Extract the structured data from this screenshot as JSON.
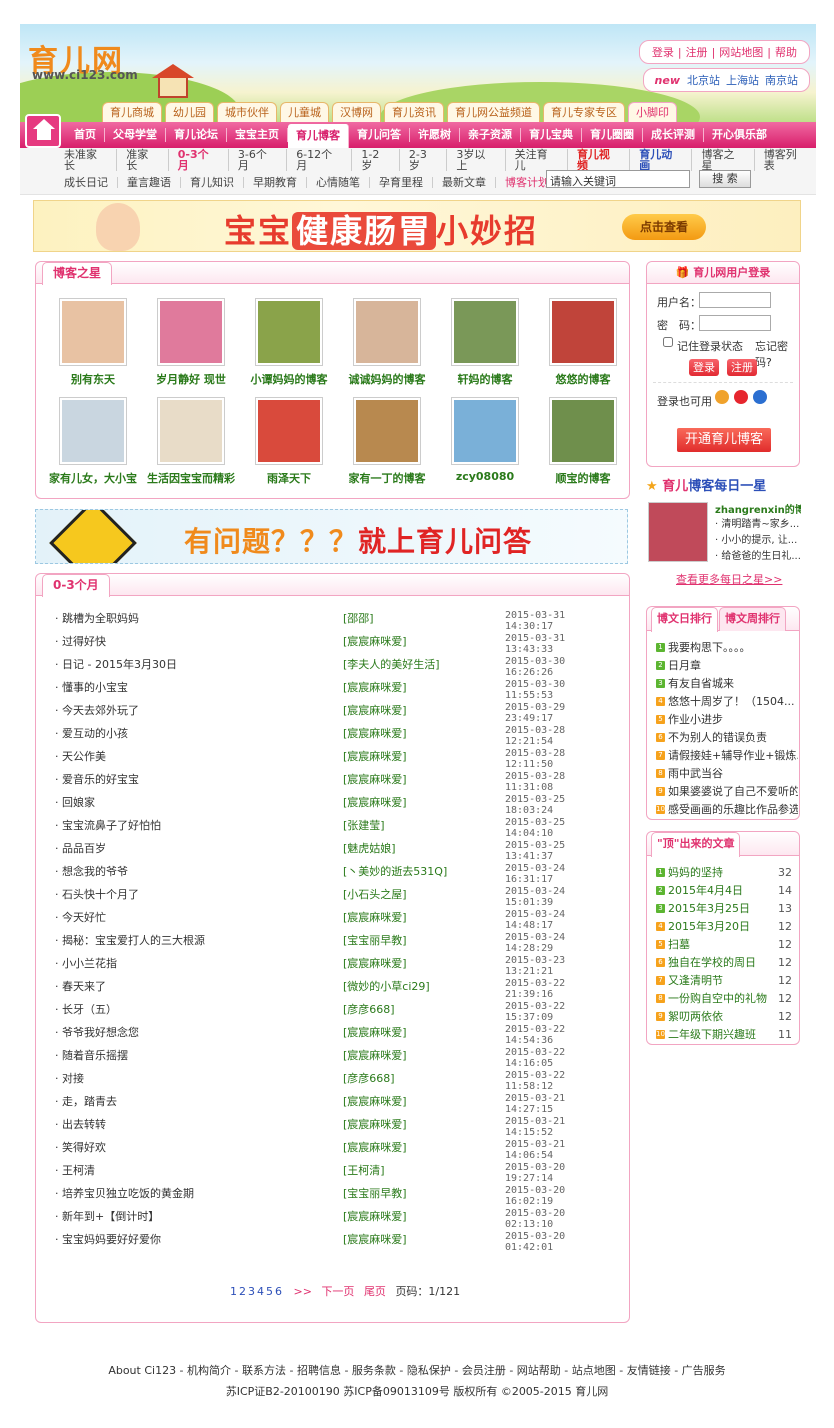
{
  "logo": {
    "text": "育儿网",
    "url": "www.ci123.com"
  },
  "toplinks": [
    "登录",
    "注册",
    "网站地图",
    "帮助"
  ],
  "cities": {
    "new": "new",
    "items": [
      "北京站",
      "上海站",
      "南京站"
    ]
  },
  "channels": [
    "育儿商城",
    "幼儿园",
    "城市伙伴",
    "儿童城",
    "汉博网",
    "育儿资讯",
    "育儿网公益频道",
    "育儿专家专区",
    "小脚印"
  ],
  "mainnav": [
    "首页",
    "父母学堂",
    "育儿论坛",
    "宝宝主页",
    "育儿博客",
    "育儿问答",
    "许愿树",
    "亲子资源",
    "育儿宝典",
    "育儿圈圈",
    "成长评测",
    "开心俱乐部"
  ],
  "subnav1": [
    "未准家长",
    "准家长",
    "0-3个月",
    "3-6个月",
    "6-12个月",
    "1-2岁",
    "2-3岁",
    "3岁以上",
    "关注育儿",
    "育儿视频",
    "育儿动画",
    "博客之星",
    "博客列表"
  ],
  "subnav2": [
    "成长日记",
    "童言趣语",
    "育儿知识",
    "早期教育",
    "心情随笔",
    "孕育里程",
    "最新文章",
    "博客计划"
  ],
  "search": {
    "value": "请输入关键词",
    "button": "搜 索"
  },
  "banner1": {
    "pre": "宝宝",
    "mid": "健康肠胃",
    "post": "小妙招",
    "button": "点击查看"
  },
  "stars": {
    "title": "博客之星",
    "items": [
      {
        "name": "别有东天",
        "color": "#e8c2a3"
      },
      {
        "name": "岁月静好  现世",
        "color": "#e07a9c"
      },
      {
        "name": "小谭妈妈的博客",
        "color": "#8aa34a"
      },
      {
        "name": "诚诚妈妈的博客",
        "color": "#d7b59a"
      },
      {
        "name": "轩妈的博客",
        "color": "#7a9858"
      },
      {
        "name": "悠悠的博客",
        "color": "#c0443a"
      },
      {
        "name": "家有儿女，大小宝",
        "color": "#c9d6e0"
      },
      {
        "name": "生活因宝宝而精彩",
        "color": "#e8dcc8"
      },
      {
        "name": "雨泽天下",
        "color": "#d94a3c"
      },
      {
        "name": "家有一丁的博客",
        "color": "#b8894f"
      },
      {
        "name": "zcy08080",
        "color": "#7ab0d8"
      },
      {
        "name": "顺宝的博客",
        "color": "#6f8f4c"
      }
    ]
  },
  "banner2": {
    "a": "有问题",
    "b": "？？？",
    "c": "就上育儿问答"
  },
  "list": {
    "title": "0-3个月",
    "rows": [
      [
        "跳槽为全职妈妈",
        "[邵邵]",
        "2015-03-31 14:30:17"
      ],
      [
        "过得好快",
        "[宸宸麻咪爱]",
        "2015-03-31 13:43:33"
      ],
      [
        "日记 - 2015年3月30日",
        "[李夫人的美好生活]",
        "2015-03-30 16:26:26"
      ],
      [
        "懂事的小宝宝",
        "[宸宸麻咪爱]",
        "2015-03-30 11:55:53"
      ],
      [
        "今天去郊外玩了",
        "[宸宸麻咪爱]",
        "2015-03-29 23:49:17"
      ],
      [
        "爱互动的小孩",
        "[宸宸麻咪爱]",
        "2015-03-28 12:21:54"
      ],
      [
        "天公作美",
        "[宸宸麻咪爱]",
        "2015-03-28 12:11:50"
      ],
      [
        "爱音乐的好宝宝",
        "[宸宸麻咪爱]",
        "2015-03-28 11:31:08"
      ],
      [
        "回娘家",
        "[宸宸麻咪爱]",
        "2015-03-25 18:03:24"
      ],
      [
        "宝宝流鼻子了好怕怕",
        "[张建莹]",
        "2015-03-25 14:04:10"
      ],
      [
        "品品百岁",
        "[魅虎姑娘]",
        "2015-03-25 13:41:37"
      ],
      [
        "想念我的爷爷",
        "[丶美妙的逝去531Q]",
        "2015-03-24 16:31:17"
      ],
      [
        "石头快十个月了",
        "[小石头之屋]",
        "2015-03-24 15:01:39"
      ],
      [
        "今天好忙",
        "[宸宸麻咪爱]",
        "2015-03-24 14:48:17"
      ],
      [
        "揭秘：宝宝爱打人的三大根源",
        "[宝宝丽早教]",
        "2015-03-24 14:28:29"
      ],
      [
        "小小兰花指",
        "[宸宸麻咪爱]",
        "2015-03-23 13:21:21"
      ],
      [
        "春天来了",
        "[微妙的小草ci29]",
        "2015-03-22 21:39:16"
      ],
      [
        "长牙（五）",
        "[彦彦668]",
        "2015-03-22 15:37:09"
      ],
      [
        "爷爷我好想念您",
        "[宸宸麻咪爱]",
        "2015-03-22 14:54:36"
      ],
      [
        "随着音乐摇摆",
        "[宸宸麻咪爱]",
        "2015-03-22 14:16:05"
      ],
      [
        "对接",
        "[彦彦668]",
        "2015-03-22 11:58:12"
      ],
      [
        "走，踏青去",
        "[宸宸麻咪爱]",
        "2015-03-21 14:27:15"
      ],
      [
        "出去转转",
        "[宸宸麻咪爱]",
        "2015-03-21 14:15:52"
      ],
      [
        "笑得好欢",
        "[宸宸麻咪爱]",
        "2015-03-21 14:06:54"
      ],
      [
        "王柯清",
        "[王柯清]",
        "2015-03-20 19:27:14"
      ],
      [
        "培养宝贝独立吃饭的黄金期",
        "[宝宝丽早教]",
        "2015-03-20 16:02:19"
      ],
      [
        "新年到+【倒计时】",
        "[宸宸麻咪爱]",
        "2015-03-20 02:13:10"
      ],
      [
        "宝宝妈妈要好好爱你",
        "[宸宸麻咪爱]",
        "2015-03-20 01:42:01"
      ]
    ]
  },
  "pager": {
    "nums": [
      "1",
      "2",
      "3",
      "4",
      "5",
      "6"
    ],
    "next1": ">>",
    "next2": "下一页",
    "last": "尾页",
    "info": "页码：1/121"
  },
  "login": {
    "title": "育儿网用户登录",
    "user": "用户名：",
    "pass": "密　码：",
    "remember": "记住登录状态",
    "forgot": "忘记密码?",
    "login": "登录",
    "register": "注册",
    "also": "登录也可用",
    "open": "开通育儿博客"
  },
  "daily": {
    "title_a": "育儿",
    "title_b": "博客每日一星",
    "name": "zhangrenxin的博客",
    "lines": [
      "· 清明踏青~家乡...",
      "· 小小的提示, 让...",
      "· 给爸爸的生日礼..."
    ],
    "more": "查看更多每日之星>>"
  },
  "rank1": {
    "tab1": "博文日排行",
    "tab2": "博文周排行",
    "items": [
      "我要构思下。。。。",
      "日月章",
      "有友自省城来",
      "悠悠十周岁了！（1504...",
      "作业小进步",
      "不为别人的错误负责",
      "请假接娃+辅导作业+锻炼...",
      "雨中武当谷",
      "如果婆婆说了自己不爱听的...",
      "感受画画的乐趣比作品参选..."
    ]
  },
  "rank2": {
    "title": "\"顶\"出来的文章",
    "items": [
      [
        "妈妈的坚持",
        "32"
      ],
      [
        "2015年4月4日",
        "14"
      ],
      [
        "2015年3月25日",
        "13"
      ],
      [
        "2015年3月20日",
        "12"
      ],
      [
        "扫墓",
        "12"
      ],
      [
        "独自在学校的周日",
        "12"
      ],
      [
        "又逢清明节",
        "12"
      ],
      [
        "一份购自空中的礼物",
        "12"
      ],
      [
        "絮叨两依依",
        "12"
      ],
      [
        "二年级下期兴趣班",
        "11"
      ]
    ]
  },
  "footer": {
    "links": "About Ci123 - 机构简介 - 联系方法 - 招聘信息 - 服务条款 - 隐私保护 - 会员注册 - 网站帮助 - 站点地图 - 友情链接 - 广告服务",
    "copy": "苏ICP证B2-20100190 苏ICP备09013109号 版权所有 ©2005-2015 育儿网"
  },
  "colors": {
    "pink": "#e0326f",
    "green": "#2a7a1a",
    "rankcolors": [
      "#5cb531",
      "#5cb531",
      "#5cb531",
      "#f6a21c",
      "#f6a21c",
      "#f6a21c",
      "#f6a21c",
      "#f6a21c",
      "#f6a21c",
      "#f6a21c"
    ]
  }
}
